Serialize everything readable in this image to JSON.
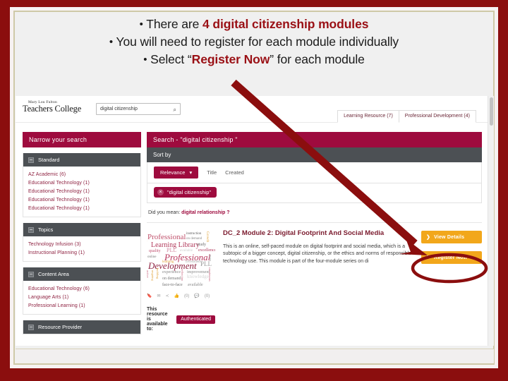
{
  "slide": {
    "bullets": [
      {
        "prefix": "There are ",
        "highlight": "4 digital citizenship modules",
        "suffix": ""
      },
      {
        "prefix": "You will need to register for each module individually",
        "highlight": "",
        "suffix": ""
      },
      {
        "prefix": "Select “",
        "highlight": "Register Now",
        "suffix": "” for each module"
      }
    ],
    "border_color": "#8B0E0E",
    "accent_color": "#9A1015"
  },
  "screenshot": {
    "header": {
      "logo_line1": "Mary Lou Fulton",
      "logo_line2": "Teachers College",
      "search_value": "digital citizenship",
      "search_placeholder": "Search",
      "search_icon": "search-icon",
      "tabs": [
        {
          "label": "Learning Resource (7)"
        },
        {
          "label": "Professional Development (4)"
        }
      ]
    },
    "sidebar": {
      "title": "Narrow your search",
      "facets": [
        {
          "name": "Standard",
          "collapse_icon": "minus-icon",
          "items": [
            "AZ Academic (6)",
            "Educational Technology (1)",
            "Educational Technology (1)",
            "Educational Technology (1)",
            "Educational Technology (1)"
          ]
        },
        {
          "name": "Topics",
          "collapse_icon": "minus-icon",
          "items": [
            "Technology Infusion (3)",
            "Instructional Planning (1)"
          ]
        },
        {
          "name": "Content Area",
          "collapse_icon": "minus-icon",
          "items": [
            "Educational Technology (6)",
            "Language Arts (1)",
            "Professional Learning (1)"
          ]
        },
        {
          "name": "Resource Provider",
          "collapse_icon": "minus-icon",
          "items": []
        }
      ]
    },
    "results": {
      "header": "Search - \"digital citizenship \"",
      "sort_label": "Sort by",
      "sort_selected": "Relevance",
      "sort_caret": "chevron-down-icon",
      "sort_options": [
        "Title",
        "Created"
      ],
      "active_filter": "\"digital citizenship\"",
      "active_filter_remove_icon": "close-circle-icon",
      "did_you_mean_prefix": "Did you mean:",
      "did_you_mean_term": "digital relationship ?",
      "item": {
        "title": "DC_2 Module 2: Digital Footprint And Social Media",
        "description": "This is an online, self-paced module on digital footprint and social media, which is a subtopic of a bigger concept, digital citizenship, or the ethics and norms of responsible technology use. This module is part of the four-module series on di",
        "thumbnail_alt": "Professional Learning Library word cloud",
        "thumbnail_words": [
          "Professional",
          "Learning Library",
          "Professional",
          "Development",
          "PLL",
          "quality",
          "online",
          "instruction",
          "on demand",
          "study",
          "excellence",
          "available",
          "experience",
          "improvement",
          "face-to-face",
          "knowledge",
          "growth",
          "learning",
          "reflection",
          "continuous",
          "active",
          "ongoing",
          "teams"
        ],
        "social_icons": [
          "bookmark-icon",
          "envelope-icon",
          "share-icon",
          "thumbs-up-icon",
          "comment-icon"
        ],
        "like_count": "(0)",
        "comment_count": "(0)",
        "availability_label": "This resource is available to:",
        "availability_badge": "Authenticated",
        "buttons": [
          {
            "label": "View Details",
            "icon": "chevron-right-icon"
          },
          {
            "label": "Register Now",
            "icon": "pencil-icon"
          }
        ]
      }
    },
    "scrollbar": "vertical-scrollbar"
  },
  "annotation": {
    "arrow": "red-arrow-pointing-to-register-now",
    "ellipse": "red-ellipse-around-register-now",
    "color": "#8B0E0E"
  }
}
